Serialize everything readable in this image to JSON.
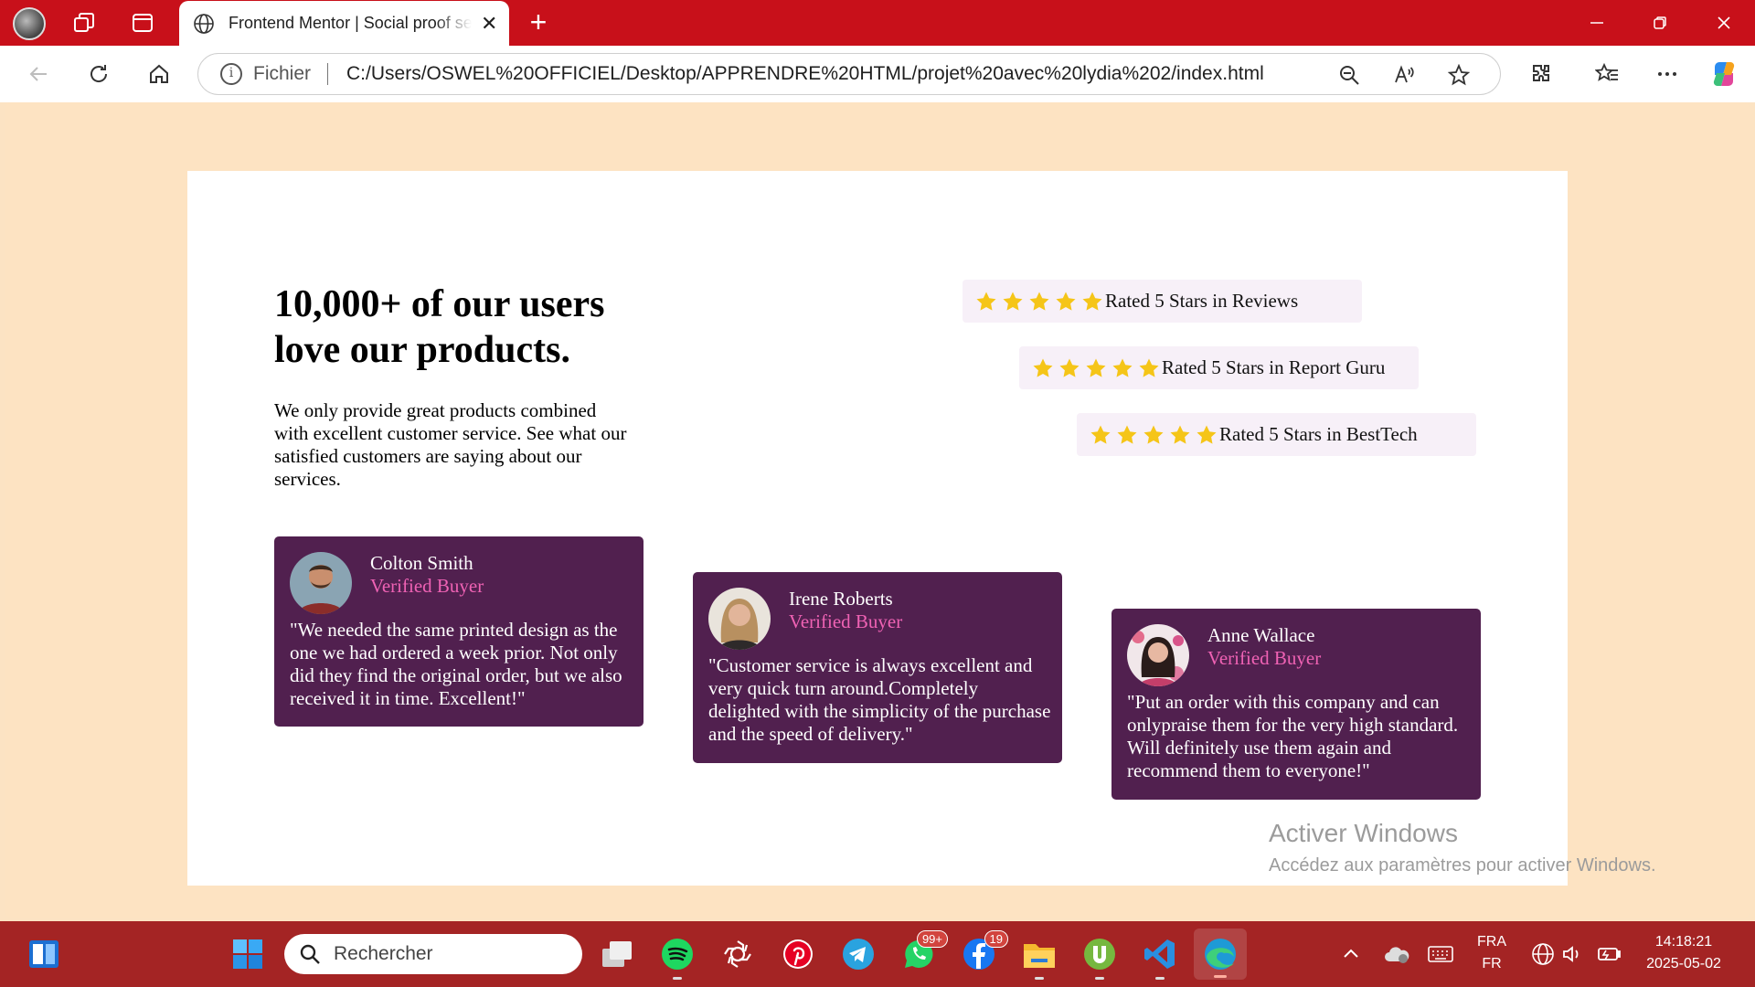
{
  "browser": {
    "tab_title": "Frontend Mentor | Social proof se",
    "new_tab_symbol": "+",
    "address_label": "Fichier",
    "url": "C:/Users/OSWEL%20OFFICIEL/Desktop/APPRENDRE%20HTML/projet%20avec%20lydia%202/index.html"
  },
  "page": {
    "heading": "10,000+ of our users love our products.",
    "intro": "We only provide great products combined with excellent customer service. See what our satisfied customers are saying about our services.",
    "ratings": [
      {
        "label": "Rated 5 Stars in Reviews",
        "stars": 5
      },
      {
        "label": "Rated 5 Stars in Report Guru",
        "stars": 5
      },
      {
        "label": "Rated 5 Stars in BestTech",
        "stars": 5
      }
    ],
    "testimonials": [
      {
        "name": "Colton Smith",
        "role": "Verified Buyer",
        "quote": "\"We needed the same printed design as the one we had ordered a week prior. Not only did they find the original order, but we also received it in time. Excellent!\""
      },
      {
        "name": "Irene Roberts",
        "role": "Verified Buyer",
        "quote": "\"Customer service is always excellent and very quick turn around.Completely delighted with the simplicity of the purchase and the speed of delivery.\""
      },
      {
        "name": "Anne Wallace",
        "role": "Verified Buyer",
        "quote": "\"Put an order with this company and can onlypraise them for the very high standard. Will definitely use them again and recommend them to everyone!\""
      }
    ],
    "colors": {
      "background": "#fde3c2",
      "card": "#51204f",
      "accent": "#ef62b4",
      "star": "#f5c518",
      "rating_bg": "#f7f0f8"
    }
  },
  "watermark": {
    "title": "Activer Windows",
    "subtitle": "Accédez aux paramètres pour activer Windows."
  },
  "taskbar": {
    "search_placeholder": "Rechercher",
    "whatsapp_badge": "99+",
    "facebook_badge": "19",
    "language": "FRA",
    "layout": "FR",
    "time": "14:18:21",
    "date": "2025-05-02",
    "apps": [
      "widgets-icon",
      "start-icon",
      "task-view-icon",
      "spotify-icon",
      "chatgpt-icon",
      "pinterest-icon",
      "telegram-icon",
      "whatsapp-icon",
      "facebook-icon",
      "file-explorer-icon",
      "utorrent-icon",
      "vscode-icon",
      "edge-icon"
    ]
  }
}
